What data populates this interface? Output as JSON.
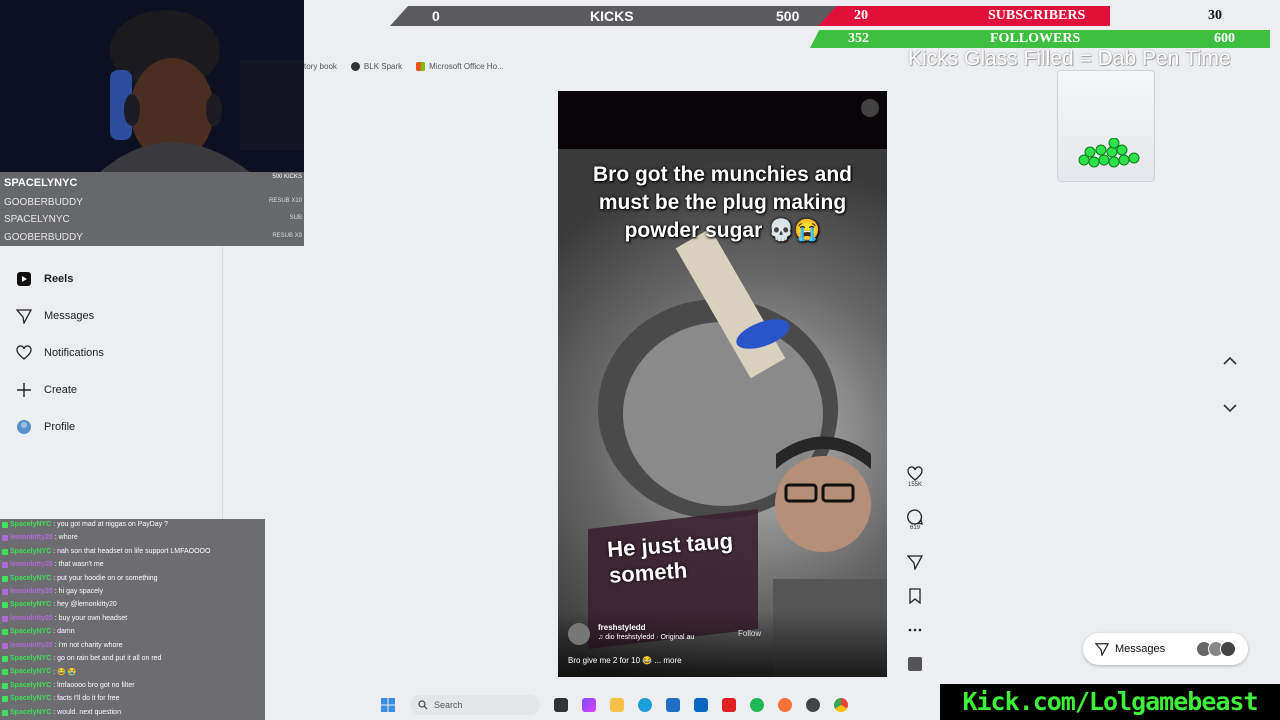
{
  "bookmarks": [
    {
      "label": "story book",
      "color": "#d5d5d5"
    },
    {
      "label": "BLK Spark",
      "color": "#333333"
    },
    {
      "label": "Microsoft Office Ho...",
      "color": "#e67e22"
    }
  ],
  "sidebar": {
    "items": [
      {
        "label": "Reels",
        "icon": "reels-icon"
      },
      {
        "label": "Messages",
        "icon": "messages-icon"
      },
      {
        "label": "Notifications",
        "icon": "heart-icon"
      },
      {
        "label": "Create",
        "icon": "plus-icon"
      },
      {
        "label": "Profile",
        "icon": "profile-avatar"
      }
    ]
  },
  "hud": {
    "kicks_current": "0",
    "kicks_label": "KICKS",
    "kicks_goal": "500",
    "subs_current": "20",
    "subs_label": "SUBSCRIBERS",
    "subs_goal": "30",
    "followers_current": "352",
    "followers_label": "FOLLOWERS",
    "followers_goal": "600",
    "glass_text": "Kicks Glass Filled = Dab Pen Time"
  },
  "subs_panel": {
    "top_name": "SPACELYNYC",
    "top_tag": "500 KICKS",
    "rows": [
      {
        "name": "GOOBERBUDDY",
        "tag": "RESUB X10"
      },
      {
        "name": "SPACELYNYC",
        "tag": "SUB"
      },
      {
        "name": "GOOBERBUDDY",
        "tag": "RESUB X9"
      }
    ]
  },
  "chat": [
    {
      "user": "SpacelyNYC",
      "color": "green",
      "msg": ": you got mad at niggas on PayDay ?"
    },
    {
      "user": "lemonkitty20",
      "color": "purple",
      "msg": ": whore"
    },
    {
      "user": "SpacelyNYC",
      "color": "green",
      "msg": ": nah son that headset on life support LMFAOOOO"
    },
    {
      "user": "lemonkitty20",
      "color": "purple",
      "msg": ": that wasn't me"
    },
    {
      "user": "SpacelyNYC",
      "color": "green",
      "msg": ": put your hoodie on or something"
    },
    {
      "user": "lemonkitty20",
      "color": "purple",
      "msg": ": hi gay spacely"
    },
    {
      "user": "SpacelyNYC",
      "color": "green",
      "msg": ": hey @lemonkitty20"
    },
    {
      "user": "lemonkitty20",
      "color": "purple",
      "msg": ": buy your own headset"
    },
    {
      "user": "SpacelyNYC",
      "color": "green",
      "msg": ": damn"
    },
    {
      "user": "lemonkitty20",
      "color": "purple",
      "msg": ": i'm not charity whore"
    },
    {
      "user": "SpacelyNYC",
      "color": "green",
      "msg": ": go on rain bet and put it all on red"
    },
    {
      "user": "SpacelyNYC",
      "color": "green",
      "msg": ": 😂 😭"
    },
    {
      "user": "SpacelyNYC",
      "color": "green",
      "msg": ": lmfaoooo bro got no filter"
    },
    {
      "user": "SpacelyNYC",
      "color": "green",
      "msg": ": facts I'll do it for free"
    },
    {
      "user": "SpacelyNYC",
      "color": "green",
      "msg": ": would. next question"
    }
  ],
  "reel": {
    "caption": "Bro got the munchies and must be the plug making powder sugar 💀😭",
    "overlay": "He just taug someth",
    "username": "freshstyledd",
    "audio": "♫ dio       freshstyledd · Original au",
    "follow_label": "Follow",
    "description": "Bro give me 2 for 10 😂 ... more"
  },
  "actions": {
    "likes": "155K",
    "comments": "619"
  },
  "messages_label": "Messages",
  "taskbar": {
    "search_placeholder": "Search"
  },
  "kick_url": "Kick.com/Lolgamebeast"
}
